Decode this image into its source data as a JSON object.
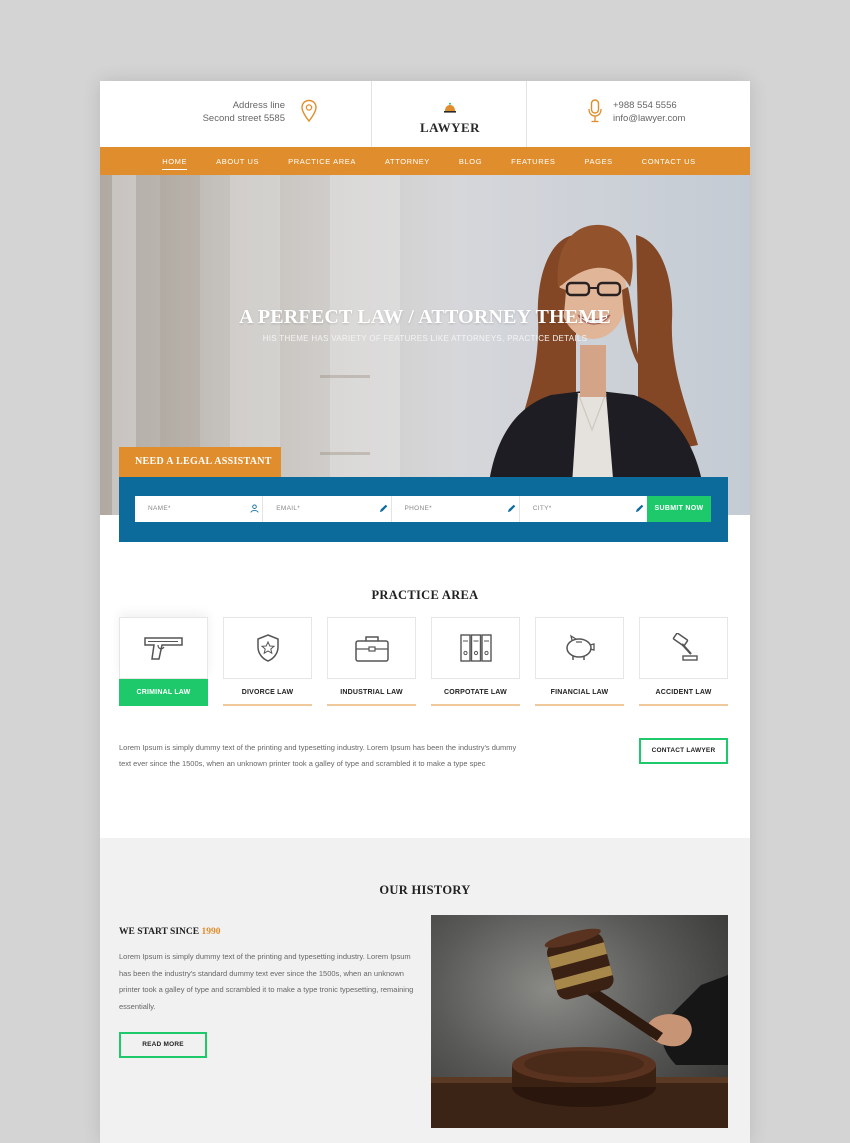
{
  "header": {
    "address_line1": "Address line",
    "address_line2": "Second street 5585",
    "logo_text": "LAWYER",
    "phone": "+988 554 5556",
    "email": "info@lawyer.com"
  },
  "nav": {
    "items": [
      "HOME",
      "ABOUT US",
      "PRACTICE AREA",
      "ATTORNEY",
      "BLOG",
      "FEATURES",
      "PAGES",
      "CONTACT US"
    ],
    "active": "HOME"
  },
  "hero": {
    "title": "A PERFECT LAW / ATTORNEY THEME",
    "subtitle": "HIS THEME HAS VARIETY OF FEATURES LIKE ATTORNEYS, PRACTICE DETAILS"
  },
  "assistant_form": {
    "tab_label": "NEED A LEGAL ASSISTANT",
    "fields": [
      {
        "placeholder": "NAME*",
        "icon": "user-icon"
      },
      {
        "placeholder": "EMAIL*",
        "icon": "pen-icon"
      },
      {
        "placeholder": "PHONE*",
        "icon": "pen-icon"
      },
      {
        "placeholder": "CITY*",
        "icon": "pen-icon"
      }
    ],
    "submit_label": "SUBMIT NOW"
  },
  "practice_area": {
    "title": "PRACTICE AREA",
    "cards": [
      {
        "label": "CRIMINAL LAW",
        "icon": "gun-icon",
        "active": true
      },
      {
        "label": "DIVORCE LAW",
        "icon": "shield-icon",
        "active": false
      },
      {
        "label": "INDUSTRIAL LAW",
        "icon": "briefcase-icon",
        "active": false
      },
      {
        "label": "CORPOTATE LAW",
        "icon": "binders-icon",
        "active": false
      },
      {
        "label": "FINANCIAL LAW",
        "icon": "piggy-bank-icon",
        "active": false
      },
      {
        "label": "ACCIDENT LAW",
        "icon": "gavel-icon",
        "active": false
      }
    ],
    "description": "Lorem Ipsum is simply dummy text of the printing and typesetting industry. Lorem Ipsum has been the industry's dummy text ever since the 1500s, when an unknown printer took a galley of type and scrambled it to make a type spec",
    "contact_button": "CONTACT LAWYER"
  },
  "history": {
    "title": "OUR HISTORY",
    "since_label": "WE START SINCE",
    "since_year": "1990",
    "description": "Lorem Ipsum is simply dummy text of the printing and typesetting industry. Lorem Ipsum has been the industry's standard dummy text ever since the 1500s, when an unknown printer took a galley of type and scrambled it to make a type tronic typesetting, remaining essentially.",
    "read_more": "READ MORE"
  },
  "colors": {
    "accent_orange": "#e08e2d",
    "form_blue": "#0c6b9a",
    "green": "#1ec96b"
  }
}
